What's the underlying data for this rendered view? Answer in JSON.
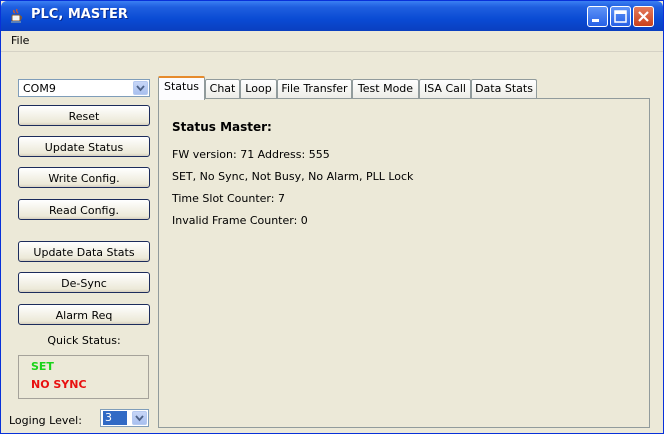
{
  "window": {
    "title": "PLC, MASTER"
  },
  "menu": {
    "file": "File"
  },
  "sidebar": {
    "port": "COM9",
    "buttons": {
      "reset": "Reset",
      "update_status": "Update Status",
      "write_config": "Write Config.",
      "read_config": "Read Config.",
      "update_data_stats": "Update Data Stats",
      "desync": "De-Sync",
      "alarm_req": "Alarm Req"
    },
    "quick_status_label": "Quick Status:",
    "quick_status": {
      "set": "SET",
      "no_sync": "NO SYNC",
      "set_color": "#19d419",
      "no_sync_color": "#e81010"
    },
    "logging_label": "Loging Level:",
    "logging_value": "3"
  },
  "tabs": [
    "Status",
    "Chat",
    "Loop",
    "File Transfer",
    "Test Mode",
    "ISA Call",
    "Data Stats"
  ],
  "active_tab": "Status",
  "status": {
    "title": "Status Master:",
    "fw_version": "FW version:  71  Address:  555",
    "flags": "SET,  No Sync,  Not Busy,  No Alarm,  PLL Lock",
    "time_slot": "Time Slot Counter:  7",
    "invalid_frame": "Invalid Frame Counter:  0"
  }
}
